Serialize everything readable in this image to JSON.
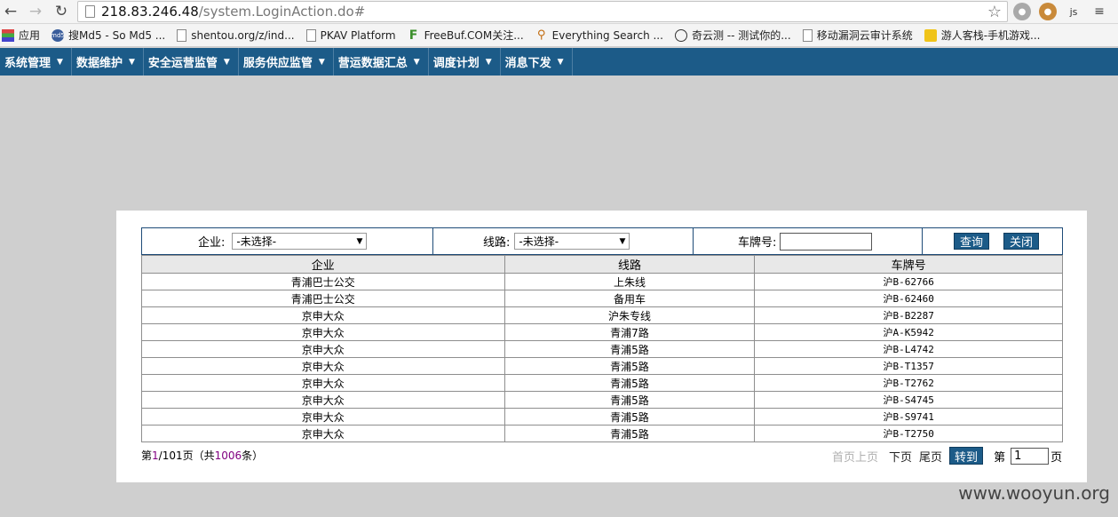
{
  "browser": {
    "url_host": "218.83.246.48",
    "url_path": "/system.LoginAction.do#",
    "bookmarks": [
      {
        "label": "应用",
        "icon": "apps-grid-icon"
      },
      {
        "label": "搜Md5 - So Md5 ...",
        "icon": "md5-icon"
      },
      {
        "label": "shentou.org/z/ind...",
        "icon": "page-icon"
      },
      {
        "label": "PKAV Platform",
        "icon": "page-icon"
      },
      {
        "label": "FreeBuf.COM关注...",
        "icon": "freebuf-icon"
      },
      {
        "label": "Everything Search ...",
        "icon": "search-icon"
      },
      {
        "label": "奇云测 -- 测试你的...",
        "icon": "clock-icon"
      },
      {
        "label": "移动漏洞云审计系统",
        "icon": "page-icon"
      },
      {
        "label": "游人客栈-手机游戏...",
        "icon": "game-icon"
      }
    ],
    "ext_js_label": "js"
  },
  "menu": [
    {
      "label": "系统管理"
    },
    {
      "label": "数据维护"
    },
    {
      "label": "安全运营监管"
    },
    {
      "label": "服务供应监管"
    },
    {
      "label": "营运数据汇总"
    },
    {
      "label": "调度计划"
    },
    {
      "label": "消息下发"
    }
  ],
  "filter": {
    "company_label": "企业:",
    "company_value": "-未选择-",
    "route_label": "线路:",
    "route_value": "-未选择-",
    "plate_label": "车牌号:",
    "plate_value": "",
    "query_button": "查询",
    "close_button": "关闭"
  },
  "table": {
    "headers": [
      "企业",
      "线路",
      "车牌号"
    ],
    "rows": [
      [
        "青浦巴士公交",
        "上朱线",
        "沪B-62766"
      ],
      [
        "青浦巴士公交",
        "备用车",
        "沪B-62460"
      ],
      [
        "京申大众",
        "沪朱专线",
        "沪B-B2287"
      ],
      [
        "京申大众",
        "青浦7路",
        "沪A-K5942"
      ],
      [
        "京申大众",
        "青浦5路",
        "沪B-L4742"
      ],
      [
        "京申大众",
        "青浦5路",
        "沪B-T1357"
      ],
      [
        "京申大众",
        "青浦5路",
        "沪B-T2762"
      ],
      [
        "京申大众",
        "青浦5路",
        "沪B-S4745"
      ],
      [
        "京申大众",
        "青浦5路",
        "沪B-S9741"
      ],
      [
        "京申大众",
        "青浦5路",
        "沪B-T2750"
      ]
    ]
  },
  "pager": {
    "prefix": "第",
    "current": "1",
    "total_pages": "/101页（共",
    "total_records": "1006",
    "suffix": "条）",
    "first_prev": "首页上页",
    "next": "下页",
    "last": "尾页",
    "go_button": "转到",
    "page_prefix": "第",
    "page_input": "1",
    "page_suffix": "页"
  },
  "watermark": "www.wooyun.org",
  "colors": {
    "nav_bg": "#1c5b88",
    "panel_border": "#1e4b78",
    "page_bg": "#cfcfcf"
  }
}
